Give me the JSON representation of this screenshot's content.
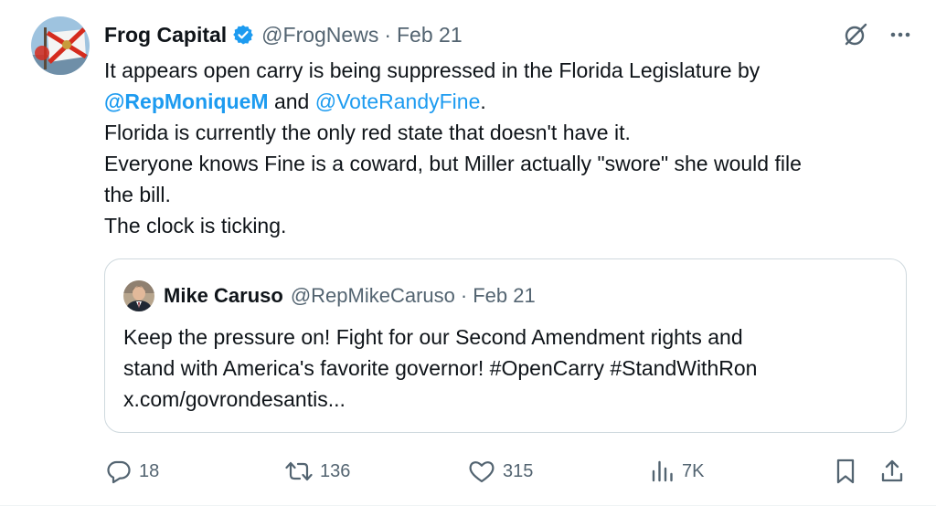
{
  "tweet": {
    "display_name": "Frog Capital",
    "handle": "@FrogNews",
    "separator": "·",
    "date": "Feb 21",
    "icons": {
      "avatar": "florida-flag-avatar",
      "verified": "verified-badge-icon",
      "grok": "grok-icon",
      "more": "more-icon"
    },
    "colors": {
      "verified": "#1d9bf0",
      "mention": "#1d9bf0",
      "muted": "#536471"
    },
    "body": {
      "line1": "It appears open carry is being suppressed in the Florida Legislature by",
      "mention1": "@RepMoniqueM",
      "and": " and ",
      "mention2": "@VoteRandyFine",
      "period": ".",
      "line3": "Florida is currently the only red state that doesn't have it.",
      "line4": "Everyone knows Fine is a coward, but Miller actually \"swore\" she would file",
      "line5": "the bill.",
      "line6": "The clock is ticking."
    }
  },
  "quote": {
    "display_name": "Mike Caruso",
    "handle": "@RepMikeCaruso",
    "separator": "·",
    "date": "Feb 21",
    "line1": "Keep the pressure on! Fight for our Second Amendment rights and",
    "line2": "stand with America's favorite governor! #OpenCarry #StandWithRon",
    "line3": "x.com/govrondesantis..."
  },
  "actions": {
    "replies": "18",
    "reposts": "136",
    "likes": "315",
    "views": "7K"
  }
}
